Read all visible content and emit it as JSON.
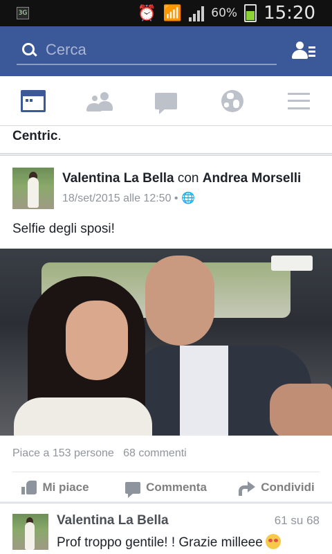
{
  "status_bar": {
    "network": "3G",
    "battery_percent": "60%",
    "battery_level": 0.6,
    "time": "15:20",
    "icons": [
      "sim-icon",
      "alarm-icon",
      "wifi-icon",
      "signal-icon",
      "battery-icon"
    ]
  },
  "header": {
    "search_placeholder": "Cerca",
    "icons": [
      "search-icon",
      "friend-requests-icon"
    ],
    "color": "#3b5998"
  },
  "tabs": [
    {
      "name": "news-feed",
      "icon": "news-feed-icon",
      "active": true
    },
    {
      "name": "friend-requests",
      "icon": "friends-icon",
      "active": false
    },
    {
      "name": "messages",
      "icon": "chat-icon",
      "active": false
    },
    {
      "name": "notifications",
      "icon": "globe-icon",
      "active": false
    },
    {
      "name": "more",
      "icon": "menu-icon",
      "active": false
    }
  ],
  "previous_post": {
    "text_bold": "Centric",
    "text_rest": "."
  },
  "post": {
    "author": "Valentina La Bella",
    "with_word": "con",
    "tagged": "Andrea Morselli",
    "date": "18/set/2015 alle 12:50",
    "separator": "•",
    "audience_icon": "globe-icon",
    "body": "Selfie degli sposi!",
    "photo": "wedding-selfie",
    "likes": "Piace a 153 persone",
    "comments": "68 commenti",
    "actions": {
      "like": "Mi piace",
      "comment": "Commenta",
      "share": "Condividi"
    }
  },
  "comment": {
    "author": "Valentina La Bella",
    "counter": "61 su 68",
    "text": "Prof troppo gentile! ! Grazie milleee",
    "emoji": "kissing-face-emoji"
  }
}
